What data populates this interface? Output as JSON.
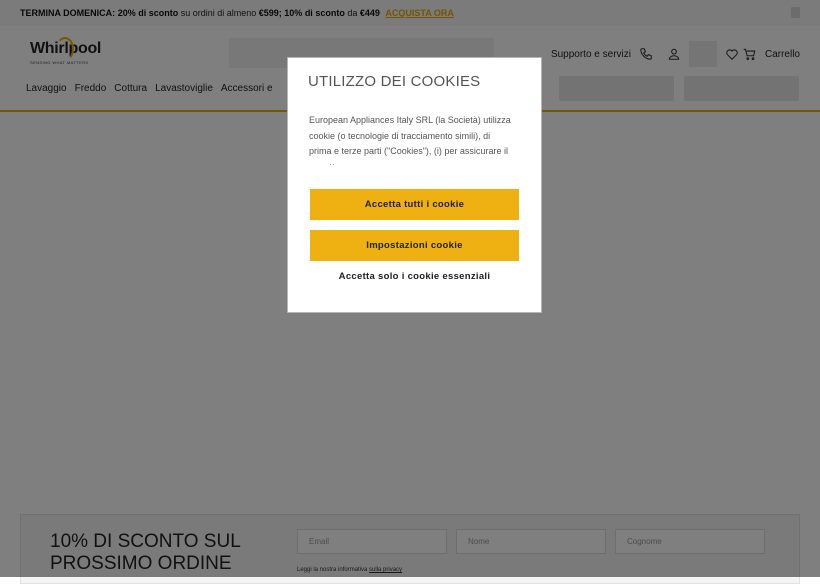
{
  "promo": {
    "part1": "TERMINA DOMENICA:",
    "part2": "20% di sconto",
    "part3": "su ordini di almeno",
    "part4": "€599; 10% di sconto",
    "part5": "da",
    "part6": "€449",
    "link": "ACQUISTA ORA"
  },
  "header": {
    "logo_text": "Whirlpool",
    "logo_tagline": "SENSING WHAT MATTERS",
    "support": "Supporto e servizi",
    "cart": "Carrello",
    "nav": [
      "Lavaggio",
      "Freddo",
      "Cottura",
      "Lavastoviglie",
      "Accessori e"
    ]
  },
  "cookie": {
    "title": "UTILIZZO DEI COOKIES",
    "body": "European Appliances Italy SRL (la Società) utilizza cookie (o tecnologie di tracciamento simili), di prima e terze parti (\"Cookies\"), (i) per assicurare il corretto",
    "accept_all": "Accetta tutti i cookie",
    "settings": "Impostazioni cookie",
    "essential_only": "Accetta solo i cookie essenziali"
  },
  "newsletter": {
    "title": "10% DI SCONTO SUL PROSSIMO ORDINE",
    "email_placeholder": "Email",
    "name_placeholder": "Nome",
    "surname_placeholder": "Cognome",
    "privacy_text": "Leggi la nostra informativa",
    "privacy_link": "sulla privacy"
  },
  "colors": {
    "accent": "#eeb111",
    "overlay": "rgba(0,0,0,0.5)"
  }
}
